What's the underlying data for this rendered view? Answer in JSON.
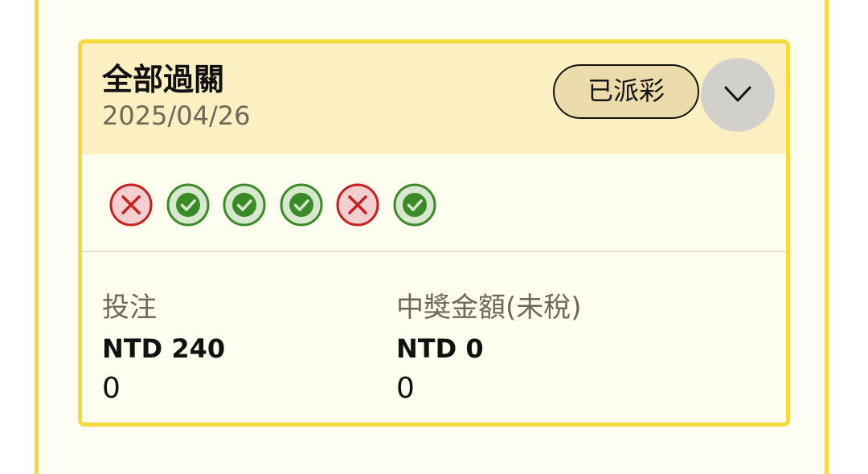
{
  "card": {
    "title": "全部過關",
    "date": "2025/04/26",
    "status": "已派彩",
    "expand_icon": "chevron-down-icon"
  },
  "results": [
    {
      "outcome": "lost",
      "icon": "cross-icon"
    },
    {
      "outcome": "won",
      "icon": "check-icon"
    },
    {
      "outcome": "won",
      "icon": "check-icon"
    },
    {
      "outcome": "won",
      "icon": "check-icon"
    },
    {
      "outcome": "lost",
      "icon": "cross-icon"
    },
    {
      "outcome": "won",
      "icon": "check-icon"
    }
  ],
  "summary": {
    "stake": {
      "label": "投注",
      "amount": "NTD 240",
      "sub": "0"
    },
    "payout": {
      "label": "中獎金額(未稅)",
      "amount": "NTD 0",
      "sub": "0"
    }
  },
  "colors": {
    "accent_border": "#f7d93a",
    "header_bg": "#fcf0c2",
    "badge_bg": "#eddcab",
    "won_stroke": "#3a8a28",
    "won_fill": "#d8e8cf",
    "lost_stroke": "#c81e1e",
    "lost_fill": "#f3d0cf"
  }
}
